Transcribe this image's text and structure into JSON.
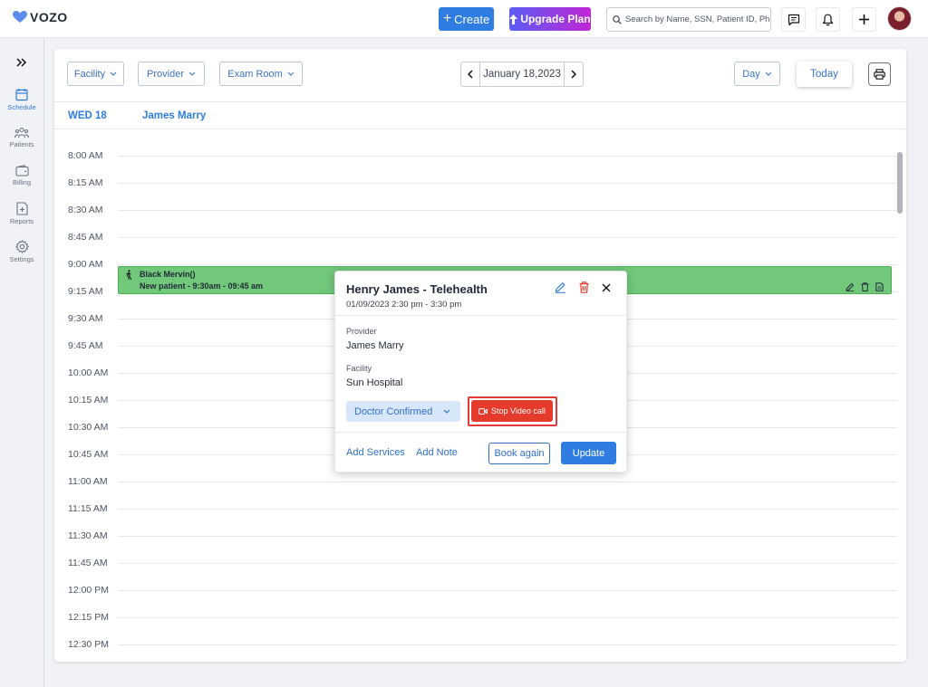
{
  "app": {
    "logo_text": "VOZO"
  },
  "topbar": {
    "create_label": "Create",
    "upgrade_label": "Upgrade Plan",
    "search_placeholder": "Search by Name, SSN, Patient ID, Phone"
  },
  "sidebar": {
    "items": [
      {
        "label": "Schedule",
        "icon": "calendar-icon",
        "active": true
      },
      {
        "label": "Patients",
        "icon": "patients-icon"
      },
      {
        "label": "Billing",
        "icon": "wallet-icon"
      },
      {
        "label": "Reports",
        "icon": "report-icon"
      },
      {
        "label": "Settings",
        "icon": "gear-icon"
      }
    ]
  },
  "toolbar": {
    "facility": "Facility",
    "provider": "Provider",
    "exam_room": "Exam Room",
    "date": "January 18,2023",
    "view": "Day",
    "today": "Today"
  },
  "calendar": {
    "day_label": "WED 18",
    "provider_name": "James Marry",
    "times": [
      "8:00 AM",
      "8:15 AM",
      "8:30 AM",
      "8:45 AM",
      "9:00 AM",
      "9:15 AM",
      "9:30 AM",
      "9:45 AM",
      "10:00 AM",
      "10:15 AM",
      "10:30 AM",
      "10:45 AM",
      "11:00 AM",
      "11:15 AM",
      "11:30 AM",
      "11:45 AM",
      "12:00 PM",
      "12:15 PM",
      "12:30 PM"
    ]
  },
  "appointment": {
    "name": "Black Mervin()",
    "description": "New patient - 9:30am - 09:45 am",
    "color": "#71c77a"
  },
  "popup": {
    "title": "Henry James - Telehealth",
    "datetime": "01/09/2023  2:30 pm - 3:30 pm",
    "provider_label": "Provider",
    "provider_value": "James Marry",
    "facility_label": "Facility",
    "facility_value": "Sun Hospital",
    "status": "Doctor Confirmed",
    "stop_video": "Stop Video call",
    "add_services": "Add Services",
    "add_note": "Add Note",
    "book_again": "Book again",
    "update": "Update"
  },
  "colors": {
    "primary": "#2f7de1",
    "danger": "#e43b2c"
  }
}
